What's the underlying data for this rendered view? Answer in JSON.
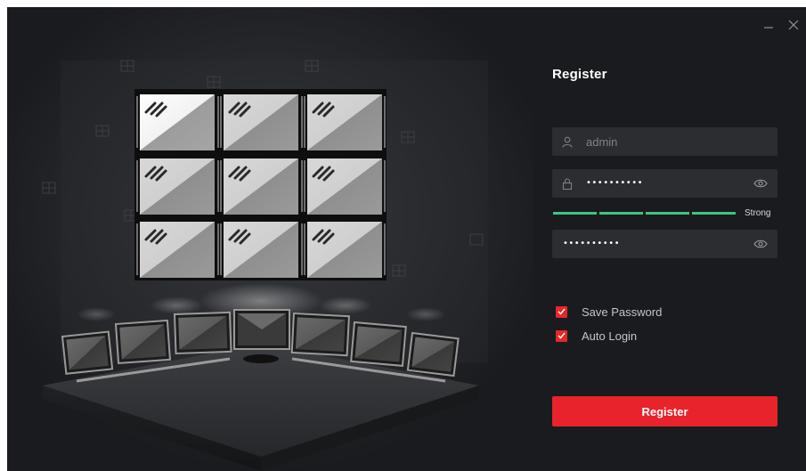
{
  "window": {
    "minimize_icon": "minus-icon",
    "close_icon": "close-icon"
  },
  "form": {
    "title": "Register",
    "username": {
      "value": "",
      "placeholder": "admin",
      "icon": "user-icon"
    },
    "password": {
      "masked": "••••••••••",
      "icon": "lock-icon",
      "toggle_icon": "eye-icon"
    },
    "strength": {
      "label": "Strong",
      "level": 4,
      "max": 4,
      "color": "#3ec387"
    },
    "confirm_password": {
      "masked": "••••••••••",
      "toggle_icon": "eye-icon"
    },
    "options": [
      {
        "label": "Save Password",
        "checked": true
      },
      {
        "label": "Auto Login",
        "checked": true
      }
    ],
    "submit_label": "Register"
  },
  "colors": {
    "accent": "#e8232b",
    "background": "#1a1b1e",
    "field_bg": "#2b2d31"
  }
}
